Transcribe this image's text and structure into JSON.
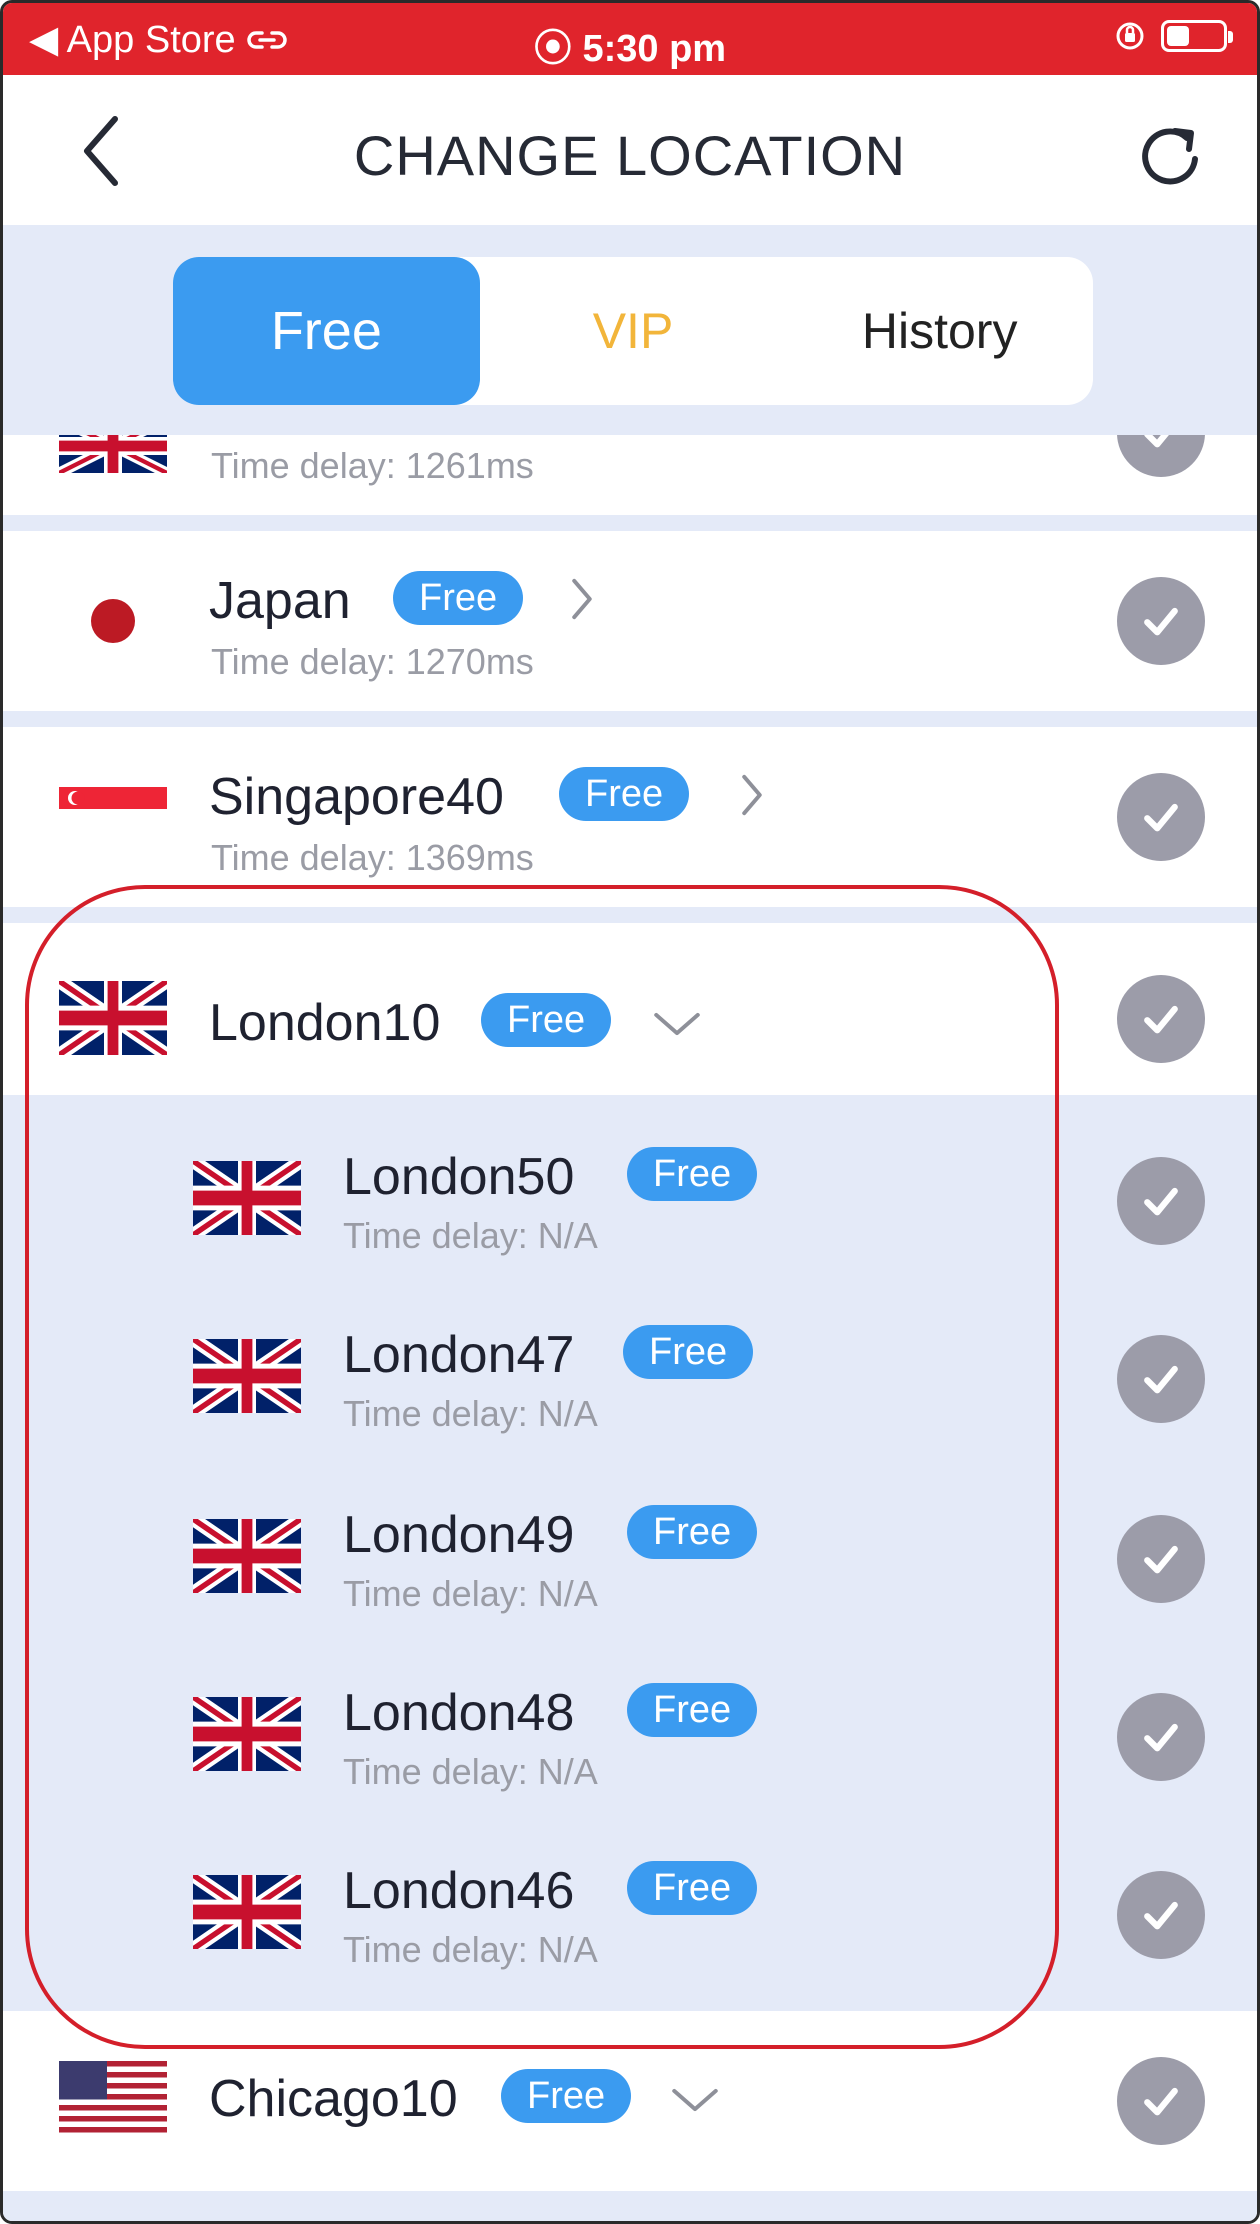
{
  "status_bar": {
    "back_app": "◀ App Store",
    "time": "⦿ 5:30 pm"
  },
  "header": {
    "title": "CHANGE LOCATION"
  },
  "tabs": [
    {
      "label": "Free"
    },
    {
      "label": "VIP"
    },
    {
      "label": "History"
    }
  ],
  "list": {
    "partial_item": {
      "delay": "Time delay: 1261ms"
    },
    "items": [
      {
        "name": "Japan",
        "badge": "Free",
        "delay": "Time delay: 1270ms"
      },
      {
        "name": "Singapore40",
        "badge": "Free",
        "delay": "Time delay: 1369ms"
      },
      {
        "name": "London10",
        "badge": "Free"
      }
    ],
    "sub_items": [
      {
        "name": "London50",
        "badge": "Free",
        "delay": "Time delay: N/A"
      },
      {
        "name": "London47",
        "badge": "Free",
        "delay": "Time delay: N/A"
      },
      {
        "name": "London49",
        "badge": "Free",
        "delay": "Time delay: N/A"
      },
      {
        "name": "London48",
        "badge": "Free",
        "delay": "Time delay: N/A"
      },
      {
        "name": "London46",
        "badge": "Free",
        "delay": "Time delay: N/A"
      }
    ],
    "last_item": {
      "name": "Chicago10",
      "badge": "Free"
    }
  },
  "colors": {
    "status_bar": "#e0242c",
    "accent": "#3b9bf0",
    "vip": "#f2b53a",
    "list_bg": "#e4eaf8",
    "check_bg": "#9c9ca9",
    "highlight": "#d41f2a"
  },
  "icons": {
    "back": "chevron-left-icon",
    "refresh": "refresh-icon",
    "check": "checkmark-icon",
    "expand": "chevron-down-icon",
    "open": "chevron-right-icon"
  }
}
